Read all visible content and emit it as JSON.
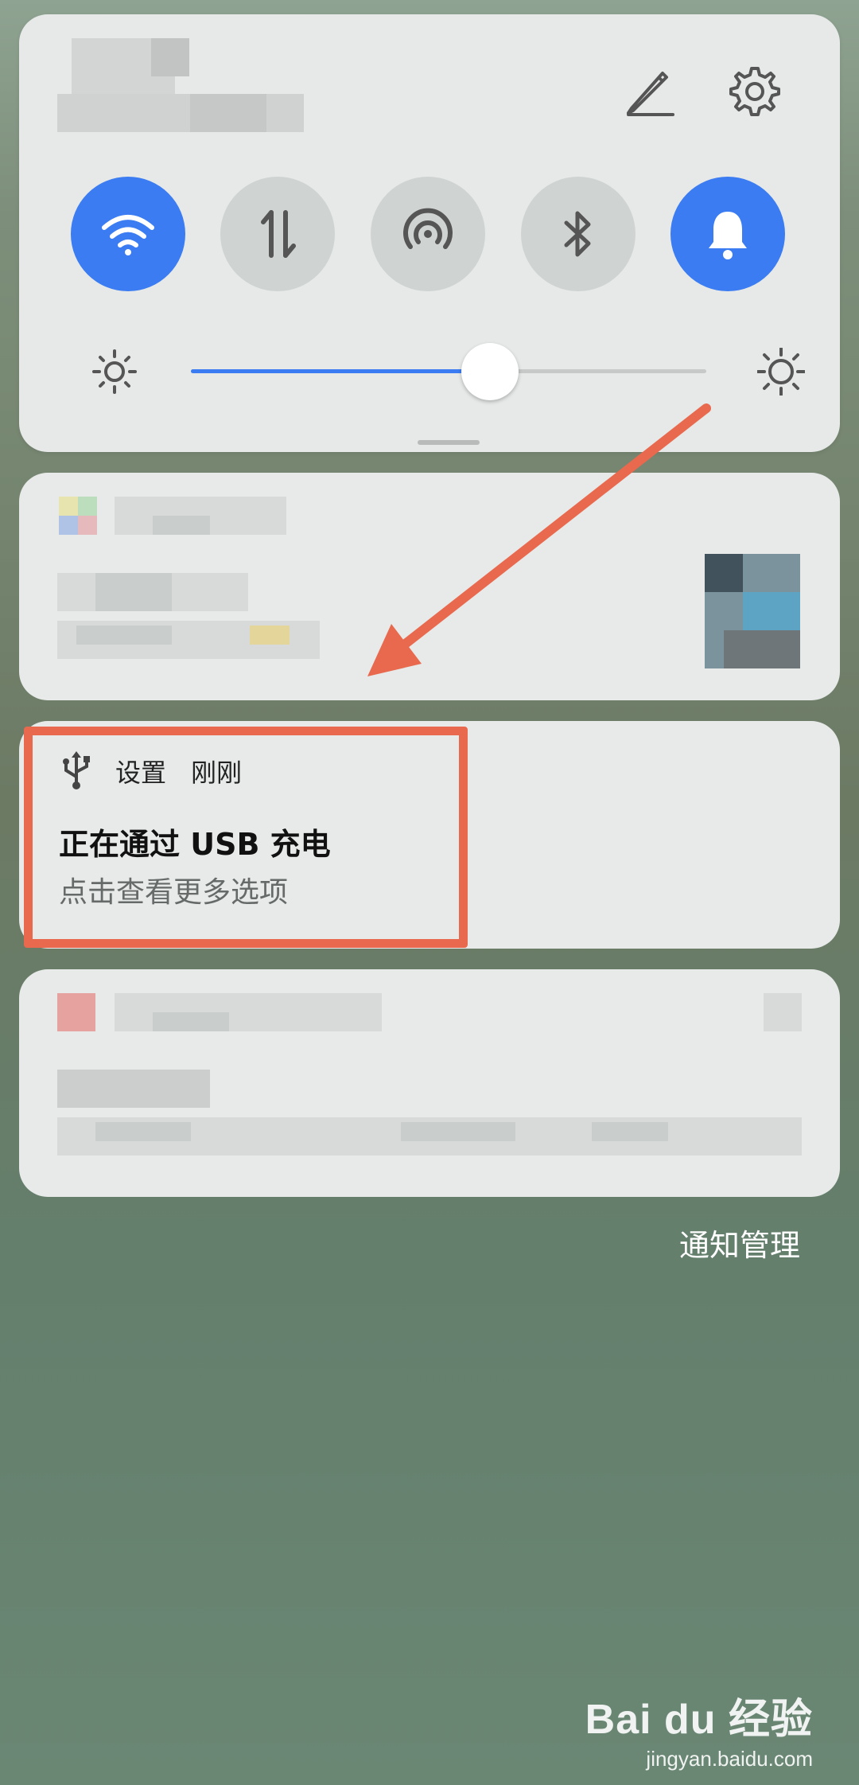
{
  "quick_settings": {
    "toggles": [
      {
        "icon": "wifi-icon",
        "state": "on"
      },
      {
        "icon": "mobile-data-icon",
        "state": "off"
      },
      {
        "icon": "hotspot-icon",
        "state": "off"
      },
      {
        "icon": "bluetooth-icon",
        "state": "off"
      },
      {
        "icon": "bell-icon",
        "state": "on"
      }
    ],
    "brightness_level": 0.58,
    "accent_color": "#3b7cf2"
  },
  "notifications": {
    "usb": {
      "app_name": "设置",
      "time": "刚刚",
      "title": "正在通过 USB 充电",
      "subtitle": "点击查看更多选项"
    },
    "manage_label": "通知管理"
  },
  "annotation": {
    "color": "#e8694e"
  },
  "watermark": {
    "brand": "Bai du 经验",
    "url": "jingyan.baidu.com"
  }
}
